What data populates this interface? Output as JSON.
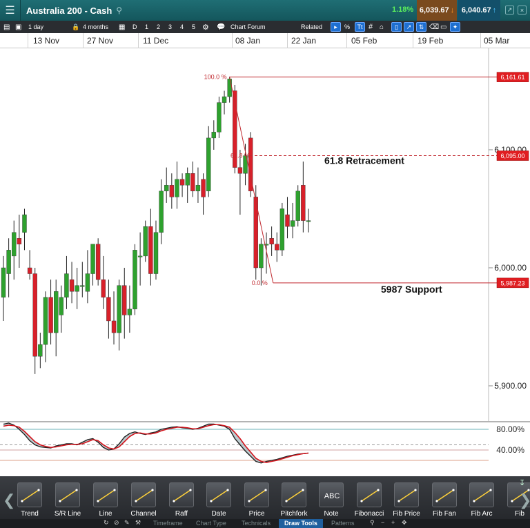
{
  "window": {
    "title": "Australia 200 - Cash",
    "change_pct": "1.18%",
    "sell_price": "6,039.67",
    "buy_price": "6,040.67"
  },
  "toolbar": {
    "interval": "1 day",
    "period": "4 months",
    "d": "D",
    "n1": "1",
    "n2": "2",
    "n3": "3",
    "n4": "4",
    "n5": "5",
    "chart_forum": "Chart Forum",
    "related": "Related",
    "pct": "%",
    "tt": "Tt"
  },
  "date_axis": [
    "13 Nov",
    "27 Nov",
    "11 Dec",
    "08 Jan",
    "22 Jan",
    "05 Feb",
    "19 Feb",
    "05 Mar"
  ],
  "price_axis": [
    "6,100.00",
    "6,000.00",
    "5,900.00"
  ],
  "price_markers": {
    "high": "6,161.61",
    "fib": "6,095.00",
    "low": "5,987.23"
  },
  "fib_labels": {
    "top": "100.0 %",
    "mid": "61.8 %",
    "bottom": "0.0 %"
  },
  "annotations": {
    "retracement": "61.8 Retracement",
    "support": "5987  Support"
  },
  "oscillator_axis": [
    "80.00%",
    "40.00%"
  ],
  "colors": {
    "up": "#2ea12e",
    "down": "#d8202a",
    "fib": "#c0282e",
    "titlebar": "#1a6066"
  },
  "tools": [
    {
      "label": "Trend",
      "icon": "trend-line-icon"
    },
    {
      "label": "S/R Line",
      "icon": "sr-line-icon"
    },
    {
      "label": "Line",
      "icon": "line-icon"
    },
    {
      "label": "Channel",
      "icon": "channel-icon"
    },
    {
      "label": "Raff",
      "icon": "raff-icon"
    },
    {
      "label": "Date",
      "icon": "date-icon"
    },
    {
      "label": "Price",
      "icon": "price-icon"
    },
    {
      "label": "Pitchfork",
      "icon": "pitchfork-icon"
    },
    {
      "label": "Note",
      "icon": "note-icon",
      "text": "ABC"
    },
    {
      "label": "Fibonacci",
      "icon": "fibonacci-icon"
    },
    {
      "label": "Fib Price",
      "icon": "fib-price-icon"
    },
    {
      "label": "Fib Fan",
      "icon": "fib-fan-icon"
    },
    {
      "label": "Fib Arc",
      "icon": "fib-arc-icon"
    },
    {
      "label": "Fib",
      "icon": "fib-icon"
    }
  ],
  "bottom_tabs": [
    "Timeframe",
    "Chart Type",
    "Technicals",
    "Draw Tools",
    "Patterns"
  ],
  "active_tab": "Draw Tools",
  "chart_data": {
    "type": "candlestick",
    "y_range": [
      5880,
      6170
    ],
    "oscillator_range": [
      0,
      100
    ],
    "oscillator_levels": [
      80,
      40
    ],
    "candles": [
      {
        "o": 5975,
        "h": 6010,
        "l": 5955,
        "c": 6000
      },
      {
        "o": 5995,
        "h": 6025,
        "l": 5975,
        "c": 6015
      },
      {
        "o": 6010,
        "h": 6040,
        "l": 5990,
        "c": 6030
      },
      {
        "o": 6025,
        "h": 6045,
        "l": 6000,
        "c": 6020
      },
      {
        "o": 6030,
        "h": 6050,
        "l": 6015,
        "c": 6045
      },
      {
        "o": 6000,
        "h": 6015,
        "l": 5990,
        "c": 5995
      },
      {
        "o": 5995,
        "h": 6000,
        "l": 5910,
        "c": 5925
      },
      {
        "o": 5925,
        "h": 5945,
        "l": 5915,
        "c": 5935
      },
      {
        "o": 5935,
        "h": 5980,
        "l": 5920,
        "c": 5975
      },
      {
        "o": 5975,
        "h": 5990,
        "l": 5935,
        "c": 5945
      },
      {
        "o": 5945,
        "h": 5990,
        "l": 5925,
        "c": 5980
      },
      {
        "o": 5960,
        "h": 5985,
        "l": 5945,
        "c": 5975
      },
      {
        "o": 5975,
        "h": 6010,
        "l": 5965,
        "c": 5995
      },
      {
        "o": 5990,
        "h": 6005,
        "l": 5970,
        "c": 5980
      },
      {
        "o": 5980,
        "h": 6000,
        "l": 5965,
        "c": 5985
      },
      {
        "o": 5985,
        "h": 6005,
        "l": 5975,
        "c": 5985
      },
      {
        "o": 5980,
        "h": 6015,
        "l": 5970,
        "c": 5995
      },
      {
        "o": 5995,
        "h": 6020,
        "l": 5985,
        "c": 6020
      },
      {
        "o": 6020,
        "h": 6025,
        "l": 5985,
        "c": 5990
      },
      {
        "o": 5990,
        "h": 6010,
        "l": 5965,
        "c": 5975
      },
      {
        "o": 5975,
        "h": 5990,
        "l": 5940,
        "c": 5955
      },
      {
        "o": 5955,
        "h": 5980,
        "l": 5935,
        "c": 5945
      },
      {
        "o": 5945,
        "h": 5990,
        "l": 5930,
        "c": 5985
      },
      {
        "o": 5985,
        "h": 6000,
        "l": 5940,
        "c": 5960
      },
      {
        "o": 5960,
        "h": 5985,
        "l": 5945,
        "c": 5965
      },
      {
        "o": 5965,
        "h": 6020,
        "l": 5960,
        "c": 6015
      },
      {
        "o": 6010,
        "h": 6030,
        "l": 5985,
        "c": 6010
      },
      {
        "o": 6010,
        "h": 6040,
        "l": 6005,
        "c": 6035
      },
      {
        "o": 6035,
        "h": 6050,
        "l": 5985,
        "c": 5995
      },
      {
        "o": 5995,
        "h": 6040,
        "l": 5990,
        "c": 6030
      },
      {
        "o": 6030,
        "h": 6075,
        "l": 6020,
        "c": 6065
      },
      {
        "o": 6065,
        "h": 6085,
        "l": 6055,
        "c": 6070
      },
      {
        "o": 6070,
        "h": 6080,
        "l": 6050,
        "c": 6060
      },
      {
        "o": 6060,
        "h": 6090,
        "l": 6050,
        "c": 6075
      },
      {
        "o": 6075,
        "h": 6080,
        "l": 6060,
        "c": 6070
      },
      {
        "o": 6070,
        "h": 6085,
        "l": 6055,
        "c": 6080
      },
      {
        "o": 6080,
        "h": 6090,
        "l": 6060,
        "c": 6065
      },
      {
        "o": 6065,
        "h": 6085,
        "l": 6055,
        "c": 6070
      },
      {
        "o": 6075,
        "h": 6080,
        "l": 6045,
        "c": 6060
      },
      {
        "o": 6065,
        "h": 6120,
        "l": 6060,
        "c": 6110
      },
      {
        "o": 6110,
        "h": 6125,
        "l": 6100,
        "c": 6115
      },
      {
        "o": 6115,
        "h": 6145,
        "l": 6110,
        "c": 6140
      },
      {
        "o": 6140,
        "h": 6150,
        "l": 6130,
        "c": 6145
      },
      {
        "o": 6145,
        "h": 6162,
        "l": 6140,
        "c": 6160
      },
      {
        "o": 6150,
        "h": 6155,
        "l": 6080,
        "c": 6085
      },
      {
        "o": 6085,
        "h": 6100,
        "l": 6045,
        "c": 6080
      },
      {
        "o": 6080,
        "h": 6105,
        "l": 6070,
        "c": 6095
      },
      {
        "o": 6110,
        "h": 6115,
        "l": 6060,
        "c": 6065
      },
      {
        "o": 6060,
        "h": 6070,
        "l": 5990,
        "c": 6000
      },
      {
        "o": 6000,
        "h": 6025,
        "l": 5985,
        "c": 6020
      },
      {
        "o": 6020,
        "h": 6030,
        "l": 5995,
        "c": 6020
      },
      {
        "o": 6025,
        "h": 6035,
        "l": 6010,
        "c": 6020
      },
      {
        "o": 6020,
        "h": 6030,
        "l": 6005,
        "c": 6015
      },
      {
        "o": 6015,
        "h": 6055,
        "l": 6010,
        "c": 6050
      },
      {
        "o": 6045,
        "h": 6060,
        "l": 6025,
        "c": 6035
      },
      {
        "o": 6035,
        "h": 6055,
        "l": 6025,
        "c": 6040
      },
      {
        "o": 6040,
        "h": 6070,
        "l": 6035,
        "c": 6065
      },
      {
        "o": 6070,
        "h": 6090,
        "l": 6030,
        "c": 6040
      },
      {
        "o": 6040,
        "h": 6050,
        "l": 6030,
        "c": 6040
      }
    ],
    "oscillator_k": [
      90,
      92,
      88,
      80,
      70,
      58,
      50,
      46,
      45,
      44,
      48,
      50,
      52,
      52,
      50,
      55,
      60,
      62,
      55,
      45,
      40,
      42,
      52,
      65,
      72,
      75,
      72,
      70,
      73,
      75,
      80,
      82,
      84,
      85,
      83,
      82,
      80,
      82,
      86,
      90,
      90,
      88,
      86,
      80,
      62,
      50,
      38,
      28,
      18,
      15,
      18,
      20,
      22,
      25,
      28,
      30,
      32,
      33,
      34
    ],
    "oscillator_d": [
      86,
      88,
      87,
      84,
      76,
      66,
      56,
      50,
      47,
      45,
      46,
      48,
      50,
      51,
      51,
      52,
      56,
      60,
      58,
      50,
      44,
      42,
      46,
      56,
      66,
      72,
      73,
      71,
      71,
      73,
      77,
      80,
      82,
      84,
      84,
      83,
      81,
      81,
      84,
      87,
      89,
      89,
      87,
      84,
      74,
      62,
      48,
      36,
      24,
      18,
      16,
      18,
      20,
      23,
      26,
      29,
      31,
      33,
      34
    ]
  }
}
